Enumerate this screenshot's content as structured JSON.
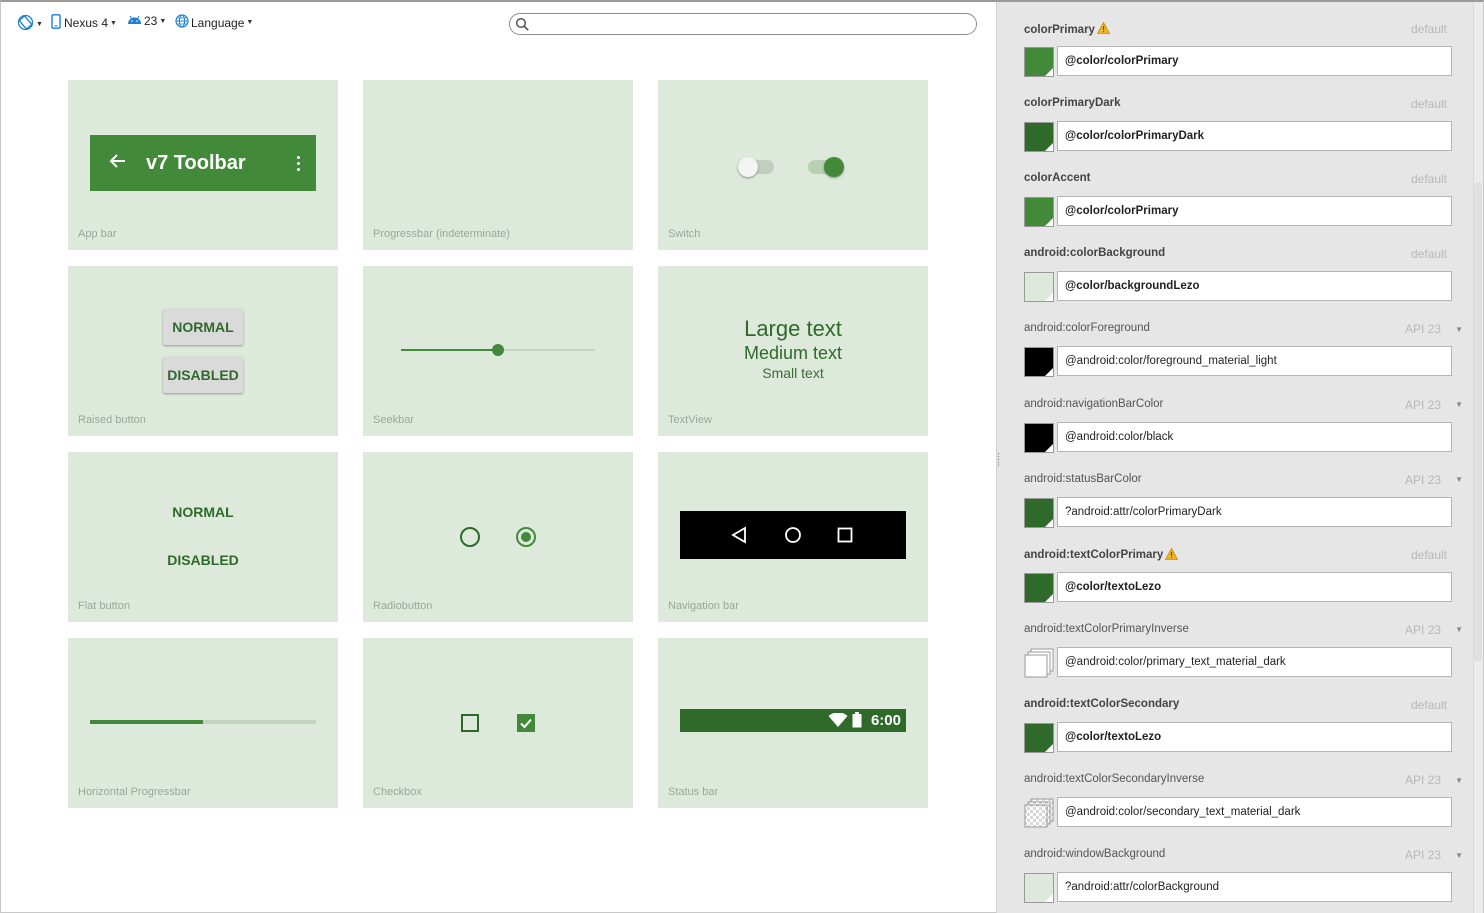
{
  "toolbar": {
    "device": "Nexus 4",
    "api": "23",
    "language": "Language",
    "search_placeholder": ""
  },
  "preview": {
    "app_bar": {
      "toolbar_title": "v7 Toolbar",
      "label": "App bar"
    },
    "progress_indeterminate": {
      "label": "Progressbar (indeterminate)"
    },
    "switch": {
      "label": "Switch"
    },
    "raised_button": {
      "normal": "NORMAL",
      "disabled": "DISABLED",
      "label": "Raised button"
    },
    "seekbar": {
      "label": "Seekbar",
      "progress": 0.5
    },
    "textview": {
      "large": "Large text",
      "medium": "Medium text",
      "small": "Small text",
      "label": "TextView"
    },
    "flat_button": {
      "normal": "NORMAL",
      "disabled": "DISABLED",
      "label": "Flat button"
    },
    "radiobutton": {
      "label": "Radiobutton"
    },
    "navigation_bar": {
      "label": "Navigation bar"
    },
    "horizontal_progress": {
      "label": "Horizontal Progressbar",
      "progress": 0.5
    },
    "checkbox": {
      "label": "Checkbox"
    },
    "status_bar": {
      "time": "6:00",
      "label": "Status bar"
    }
  },
  "colors": {
    "primary": "#43893a",
    "primary_dark": "#2f6a2a",
    "background": "#ddeadb",
    "black": "#000000",
    "white": "#ffffff"
  },
  "theme_attributes": [
    {
      "name": "colorPrimary",
      "bold": true,
      "warning": true,
      "status": "default",
      "dropdown": false,
      "value": "@color/colorPrimary",
      "value_bold": true,
      "swatch": "#43893a",
      "swatch_type": "solid"
    },
    {
      "name": "colorPrimaryDark",
      "bold": true,
      "warning": false,
      "status": "default",
      "dropdown": false,
      "value": "@color/colorPrimaryDark",
      "value_bold": true,
      "swatch": "#2f6a2a",
      "swatch_type": "solid"
    },
    {
      "name": "colorAccent",
      "bold": true,
      "warning": false,
      "status": "default",
      "dropdown": false,
      "value": "@color/colorPrimary",
      "value_bold": true,
      "swatch": "#43893a",
      "swatch_type": "solid"
    },
    {
      "name": "android:colorBackground",
      "bold": true,
      "warning": false,
      "status": "default",
      "dropdown": false,
      "value": "@color/backgroundLezo",
      "value_bold": true,
      "swatch": "#ddeadb",
      "swatch_type": "solid"
    },
    {
      "name": "android:colorForeground",
      "bold": false,
      "warning": false,
      "status": "API 23",
      "dropdown": true,
      "value": "@android:color/foreground_material_light",
      "value_bold": false,
      "swatch": "#000000",
      "swatch_type": "solid"
    },
    {
      "name": "android:navigationBarColor",
      "bold": false,
      "warning": false,
      "status": "API 23",
      "dropdown": true,
      "value": "@android:color/black",
      "value_bold": false,
      "swatch": "#000000",
      "swatch_type": "solid"
    },
    {
      "name": "android:statusBarColor",
      "bold": false,
      "warning": false,
      "status": "API 23",
      "dropdown": true,
      "value": "?android:attr/colorPrimaryDark",
      "value_bold": false,
      "swatch": "#2f6a2a",
      "swatch_type": "solid"
    },
    {
      "name": "android:textColorPrimary",
      "bold": true,
      "warning": true,
      "status": "default",
      "dropdown": false,
      "value": "@color/textoLezo",
      "value_bold": true,
      "swatch": "#2f6a2a",
      "swatch_type": "solid"
    },
    {
      "name": "android:textColorPrimaryInverse",
      "bold": false,
      "warning": false,
      "status": "API 23",
      "dropdown": true,
      "value": "@android:color/primary_text_material_dark",
      "value_bold": false,
      "swatch": "#ffffff",
      "swatch_type": "stack"
    },
    {
      "name": "android:textColorSecondary",
      "bold": true,
      "warning": false,
      "status": "default",
      "dropdown": false,
      "value": "@color/textoLezo",
      "value_bold": true,
      "swatch": "#2f6a2a",
      "swatch_type": "solid"
    },
    {
      "name": "android:textColorSecondaryInverse",
      "bold": false,
      "warning": false,
      "status": "API 23",
      "dropdown": true,
      "value": "@android:color/secondary_text_material_dark",
      "value_bold": false,
      "swatch": "#e8e8e8",
      "swatch_type": "checker"
    },
    {
      "name": "android:windowBackground",
      "bold": false,
      "warning": false,
      "status": "API 23",
      "dropdown": true,
      "value": "?android:attr/colorBackground",
      "value_bold": false,
      "swatch": "#ddeadb",
      "swatch_type": "solid"
    }
  ]
}
